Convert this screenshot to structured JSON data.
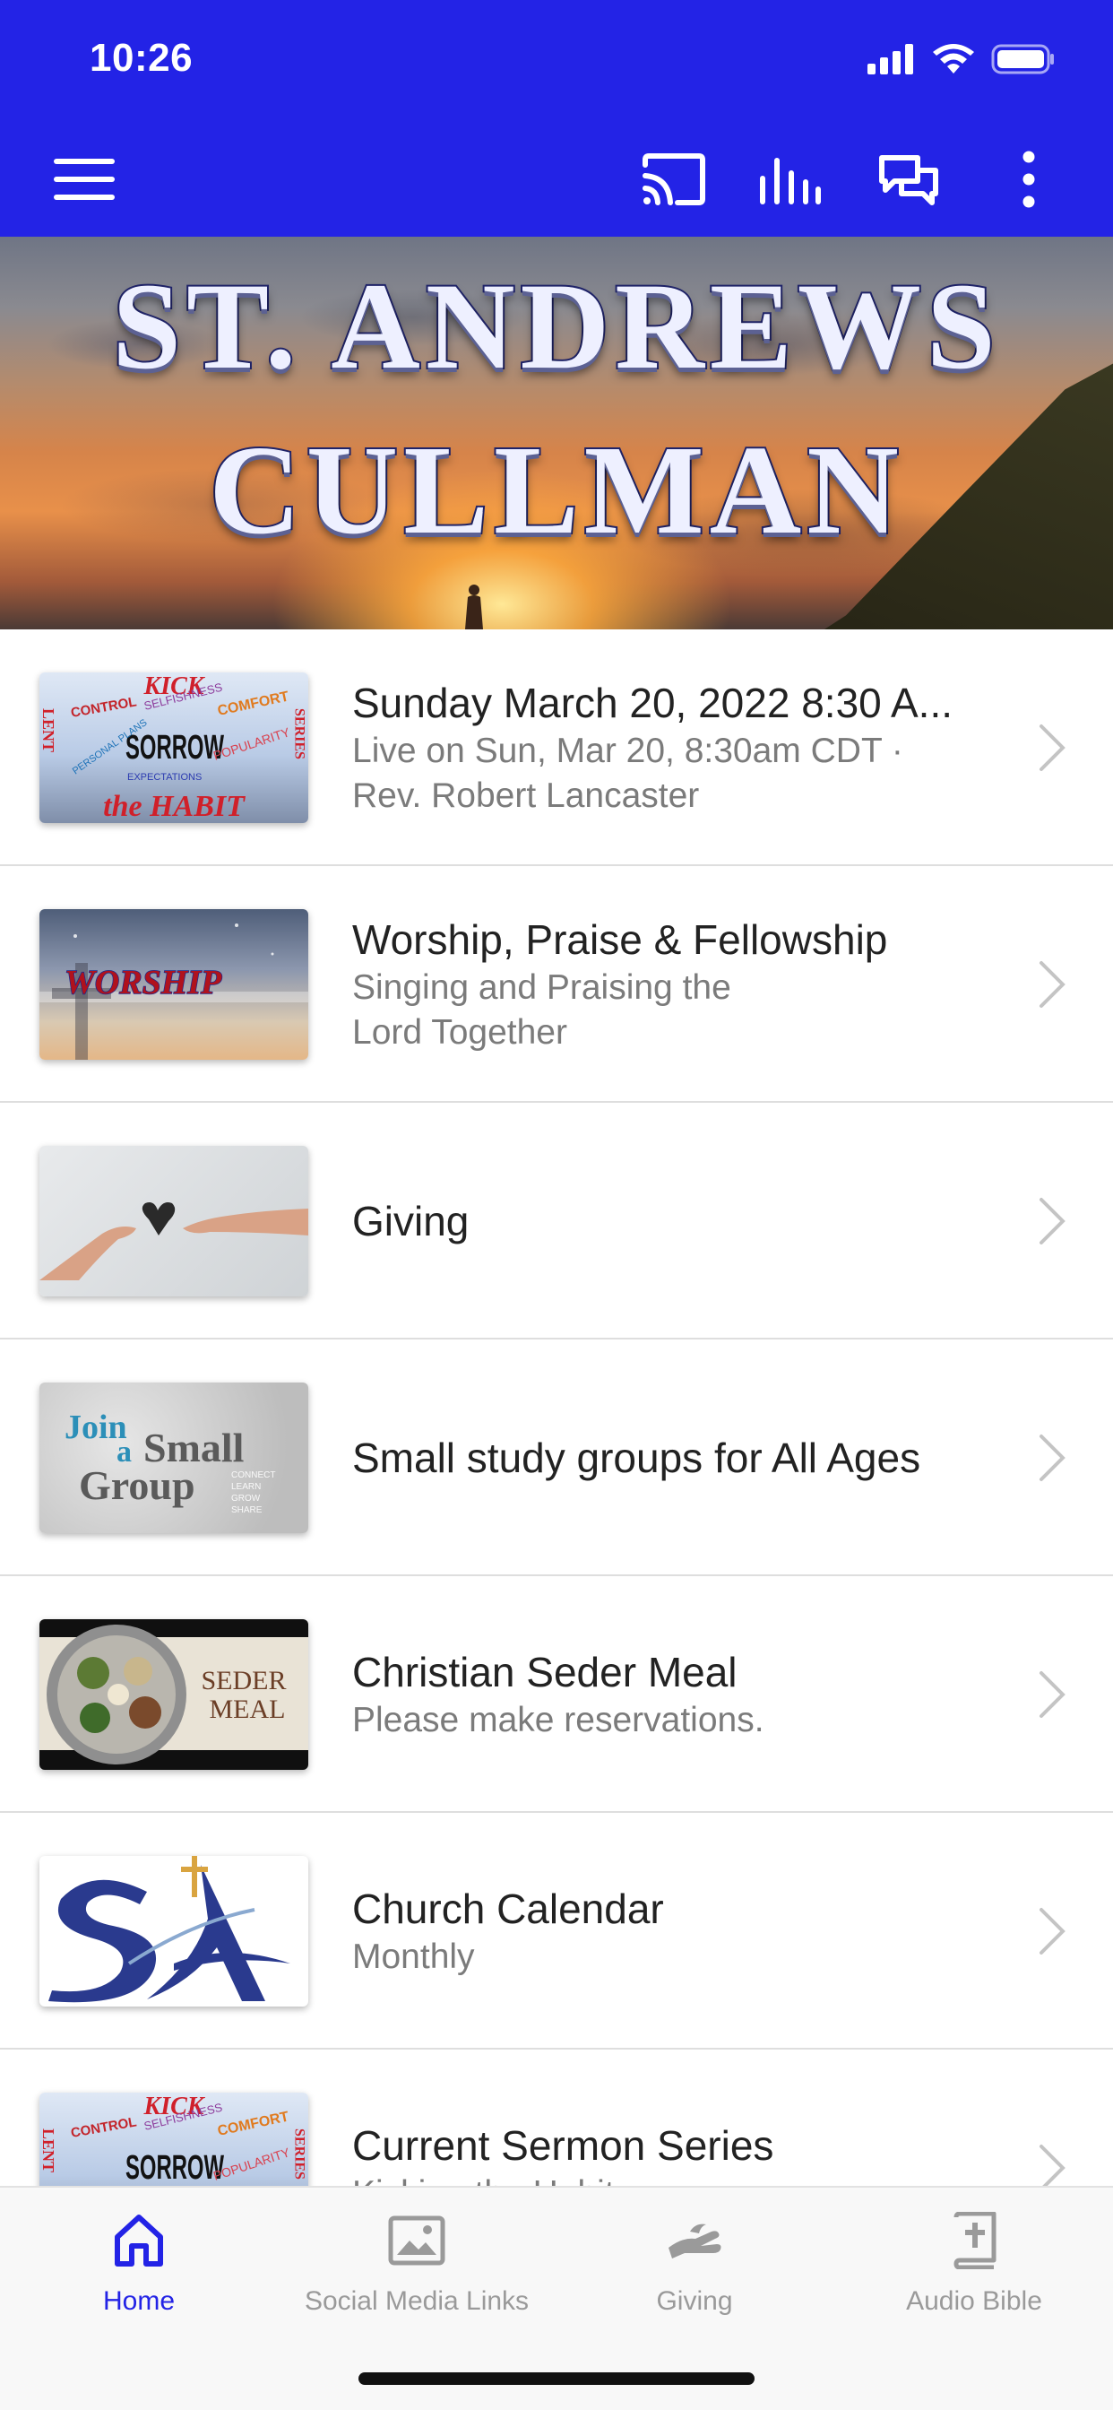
{
  "status_bar": {
    "time": "10:26"
  },
  "app_bar": {
    "icons": [
      "menu-icon",
      "cast-icon",
      "audio-bars-icon",
      "chat-icon",
      "more-vertical-icon"
    ]
  },
  "banner": {
    "line1": "ST. ANDREWS",
    "line2": "CULLMAN"
  },
  "list": [
    {
      "title": "Sunday March 20, 2022 8:30 A...",
      "subtitle_lines": [
        "Live on Sun, Mar 20, 8:30am CDT ·",
        "Rev. Robert Lancaster"
      ],
      "thumb": "sorrow"
    },
    {
      "title": "Worship, Praise & Fellowship",
      "subtitle_lines": [
        "Singing and Praising the",
        "Lord Together"
      ],
      "thumb": "worship"
    },
    {
      "title": "Giving",
      "subtitle_lines": [],
      "thumb": "giving"
    },
    {
      "title": "Small study groups for All Ages",
      "subtitle_lines": [],
      "thumb": "group"
    },
    {
      "title": "Christian Seder Meal",
      "subtitle_lines": [
        "Please make reservations."
      ],
      "thumb": "seder"
    },
    {
      "title": "Church Calendar",
      "subtitle_lines": [
        "Monthly"
      ],
      "thumb": "sa"
    },
    {
      "title": "Current Sermon Series",
      "subtitle_lines": [
        "Kicking the Habit"
      ],
      "thumb": "sorrow"
    }
  ],
  "thumb_text": {
    "sorrow_main": "SORROW",
    "sorrow_top": "KICK",
    "sorrow_bottom": "the HABIT",
    "sorrow_left": "LENT",
    "sorrow_right": "SERIES",
    "sorrow_words": [
      "CONTROL",
      "SELFISHNESS",
      "COMFORT",
      "POPULARITY",
      "EXPECTATIONS",
      "PERSONAL PLANS"
    ],
    "worship": "WORSHIP",
    "group_join": "Join",
    "group_a": "a",
    "group_small": "Small",
    "group_group": "Group",
    "group_small_words": [
      "CONNECT",
      "LEARN",
      "GROW",
      "SHARE"
    ],
    "seder_line1": "SEDER",
    "seder_line2": "MEAL"
  },
  "tabbar": {
    "tabs": [
      {
        "label": "Home",
        "icon": "home-icon",
        "active": true
      },
      {
        "label": "Social Media Links",
        "icon": "image-icon",
        "active": false
      },
      {
        "label": "Giving",
        "icon": "giving-hand-icon",
        "active": false
      },
      {
        "label": "Audio Bible",
        "icon": "bible-icon",
        "active": false
      }
    ]
  },
  "colors": {
    "primary": "#2323e6",
    "title_text": "#222222",
    "subtitle_text": "#7b7b7b",
    "inactive_tab": "#9a9a9a"
  }
}
